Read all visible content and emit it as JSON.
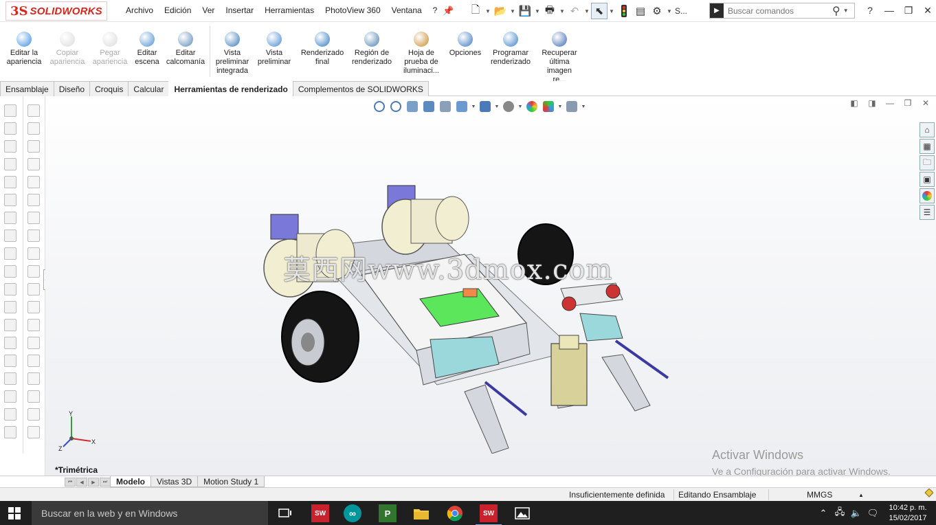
{
  "app": {
    "logo_ds": "3S",
    "logo_text": "SOLIDWORKS"
  },
  "menu": [
    "Archivo",
    "Edición",
    "Ver",
    "Insertar",
    "Herramientas",
    "PhotoView 360",
    "Ventana",
    "?"
  ],
  "quickbar": {
    "truncated_label": "S..."
  },
  "command_search": {
    "placeholder": "Buscar comandos"
  },
  "window_controls": {
    "help": "?",
    "minimize": "—",
    "restore": "❐",
    "close": "✕"
  },
  "ribbon": [
    {
      "id": "editar-apariencia",
      "label": "Editar la apariencia",
      "lines": [
        "Editar la",
        "apariencia"
      ],
      "enabled": true,
      "color": "#3b8de0"
    },
    {
      "id": "copiar-apariencia",
      "lines": [
        "Copiar",
        "apariencia"
      ],
      "enabled": false,
      "color": "#999999"
    },
    {
      "id": "pegar-apariencia",
      "lines": [
        "Pegar",
        "apariencia"
      ],
      "enabled": false,
      "color": "#999999"
    },
    {
      "id": "editar-escena",
      "lines": [
        "Editar",
        "escena"
      ],
      "enabled": true,
      "color": "#4a90d0"
    },
    {
      "id": "editar-calcomania",
      "lines": [
        "Editar",
        "calcomanía"
      ],
      "enabled": true,
      "color": "#5a8ab8"
    },
    {
      "id": "vista-preliminar-integrada",
      "lines": [
        "Vista",
        "preliminar",
        "integrada"
      ],
      "enabled": true,
      "color": "#3a7ab8"
    },
    {
      "id": "vista-preliminar",
      "lines": [
        "Vista",
        "preliminar"
      ],
      "enabled": true,
      "color": "#4a8ad0"
    },
    {
      "id": "renderizado-final",
      "lines": [
        "Renderizado",
        "final"
      ],
      "enabled": true,
      "color": "#2e7ac0"
    },
    {
      "id": "region-renderizado",
      "lines": [
        "Región de",
        "renderizado"
      ],
      "enabled": true,
      "color": "#4a80b0"
    },
    {
      "id": "hoja-prueba",
      "lines": [
        "Hoja de",
        "prueba de",
        "iluminaci..."
      ],
      "enabled": true,
      "color": "#c88a2a"
    },
    {
      "id": "opciones",
      "lines": [
        "Opciones"
      ],
      "enabled": true,
      "color": "#3a78c0"
    },
    {
      "id": "programar-renderizado",
      "lines": [
        "Programar",
        "renderizado"
      ],
      "enabled": true,
      "color": "#3a80c8"
    },
    {
      "id": "recuperar-imagen",
      "lines": [
        "Recuperar",
        "última",
        "imagen re..."
      ],
      "enabled": true,
      "color": "#3a6ab0"
    }
  ],
  "tabs": [
    {
      "label": "Ensamblaje",
      "active": false
    },
    {
      "label": "Diseño",
      "active": false
    },
    {
      "label": "Croquis",
      "active": false
    },
    {
      "label": "Calcular",
      "active": false
    },
    {
      "label": "Herramientas de renderizado",
      "active": true
    },
    {
      "label": "Complementos de SOLIDWORKS",
      "active": false
    }
  ],
  "viewport": {
    "watermark": "莫西网www.3dmox.com",
    "view_name": "*Trimétrica",
    "triad": {
      "x": "X",
      "y": "Y",
      "z": "Z"
    }
  },
  "activation": {
    "title": "Activar Windows",
    "subtitle": "Ve a Configuración para activar Windows."
  },
  "model_tabs": [
    {
      "label": "Modelo",
      "active": true
    },
    {
      "label": "Vistas 3D",
      "active": false
    },
    {
      "label": "Motion Study 1",
      "active": false
    }
  ],
  "status": {
    "definition": "Insuficientemente definida",
    "mode": "Editando Ensamblaje",
    "units": "MMGS",
    "units_arrow": "▲"
  },
  "taskbar": {
    "search_placeholder": "Buscar en la web y en Windows",
    "apps": [
      {
        "name": "task-view",
        "label": ""
      },
      {
        "name": "solidworks-2016-a",
        "label": "SW"
      },
      {
        "name": "arduino",
        "label": "∞"
      },
      {
        "name": "project",
        "label": "P"
      },
      {
        "name": "file-explorer",
        "label": ""
      },
      {
        "name": "chrome",
        "label": ""
      },
      {
        "name": "solidworks-2016-b",
        "label": "SW"
      },
      {
        "name": "photos",
        "label": ""
      }
    ],
    "time": "10:42 p. m.",
    "date": "15/02/2017"
  }
}
